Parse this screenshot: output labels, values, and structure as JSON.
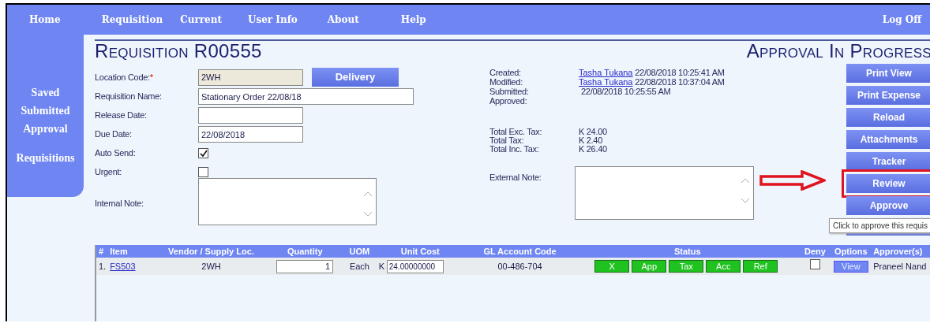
{
  "nav": {
    "items": [
      {
        "label": "Home"
      },
      {
        "label": "Requisition"
      },
      {
        "label": "Current"
      },
      {
        "label": "User Info"
      },
      {
        "label": "About"
      },
      {
        "label": "Help"
      }
    ],
    "logoff": "Log Off"
  },
  "sidebar": {
    "items": [
      {
        "label": "Saved"
      },
      {
        "label": "Submitted"
      },
      {
        "label": "Approval"
      }
    ],
    "footer": "Requisitions"
  },
  "title": "Requisition R00555",
  "state_title": "Approval In Progress",
  "form": {
    "fields": [
      {
        "kind": "text",
        "label": "Location Code:",
        "required_mark": "*",
        "value": "2WH",
        "readonly": true,
        "button": "Delivery"
      },
      {
        "kind": "text",
        "label": "Requisition Name:",
        "value": "Stationary Order 22/08/18",
        "wide": true
      },
      {
        "kind": "text",
        "label": "Release Date:"
      },
      {
        "kind": "text",
        "label": "Due Date:",
        "value": "22/08/2018"
      },
      {
        "kind": "checkbox",
        "label": "Auto Send:",
        "checked": true
      },
      {
        "kind": "checkbox",
        "label": "Urgent:",
        "checked": false
      },
      {
        "kind": "textarea",
        "label": "Internal Note:"
      }
    ]
  },
  "info": {
    "events": [
      {
        "label": "Created:",
        "user": "Tasha Tukana",
        "time": "22/08/2018 10:25:41 AM"
      },
      {
        "label": "Modified:",
        "user": "Tasha Tukana",
        "time": "22/08/2018 10:37:04 AM"
      },
      {
        "label": "Submitted:",
        "time": "22/08/2018 10:25:55 AM"
      },
      {
        "label": "Approved:"
      }
    ],
    "totals": [
      {
        "label": "Total Exc. Tax:",
        "value": "K 24.00"
      },
      {
        "label": "Total Tax:",
        "value": "K 2.40"
      },
      {
        "label": "Total Inc. Tax:",
        "value": "K 26.40"
      }
    ],
    "external_note": "External Note:"
  },
  "actions": [
    {
      "label": "Print View",
      "highlighted": false
    },
    {
      "label": "Print Expense",
      "highlighted": false
    },
    {
      "label": "Reload",
      "highlighted": false
    },
    {
      "label": "Attachments",
      "highlighted": false
    },
    {
      "label": "Tracker",
      "highlighted": false
    },
    {
      "label": "Review",
      "highlighted": true
    },
    {
      "label": "Approve",
      "highlighted": false
    }
  ],
  "tooltip": "Click to approve this requis",
  "table": {
    "columns": [
      "#",
      "Item",
      "Vendor / Supply Loc.",
      "Quantity",
      "UOM",
      "Unit Cost",
      "GL Account Code",
      "Status",
      "Deny",
      "Options",
      "Approver(s)"
    ],
    "rows": [
      {
        "number": "1.",
        "item": "FS503",
        "vendor": "2WH",
        "quantity": "1",
        "uom": "Each",
        "currency": "K",
        "unit_cost": "24.00000000",
        "gl_account": "00-486-704",
        "statuses": [
          {
            "label": "X",
            "color": "#1fc21f"
          },
          {
            "label": "App",
            "color": "#1fc21f"
          },
          {
            "label": "Tax",
            "color": "#1fc21f"
          },
          {
            "label": "Acc",
            "color": "#1fc21f"
          },
          {
            "label": "Ref",
            "color": "#1fc21f"
          }
        ],
        "deny": false,
        "option": "View",
        "approver": "Praneel Nand"
      }
    ]
  }
}
